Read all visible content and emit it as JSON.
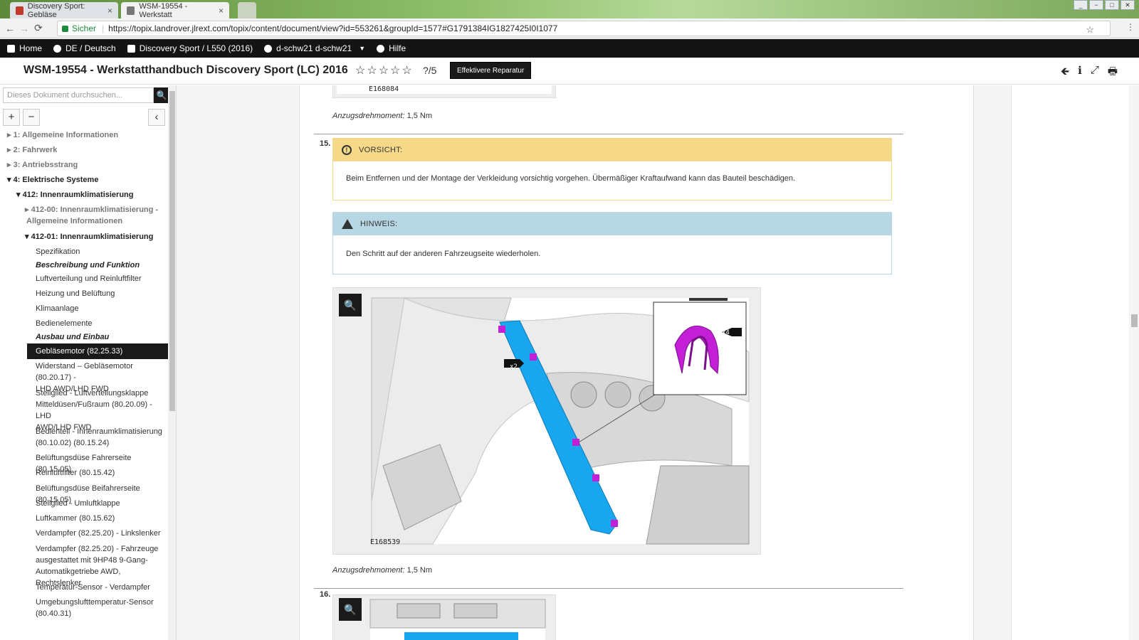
{
  "browser": {
    "tabs": [
      {
        "label": "Discovery Sport: Gebläse",
        "close": "×"
      },
      {
        "label": "WSM-19554 - Werkstatt",
        "close": "×"
      }
    ],
    "window_buttons": [
      "_",
      "−",
      "□",
      "✕"
    ],
    "nav": {
      "back": "←",
      "forward": "→",
      "reload": "⟳"
    },
    "secure_label": "Sicher",
    "url": "https://topix.landrover.jlrext.com/topix/content/document/view?id=553261&groupId=1577#G1791384IG1827425I0I1077",
    "bookmark": "☆",
    "menu": "⋮"
  },
  "appnav": {
    "home": "Home",
    "language": "DE / Deutsch",
    "vehicle": "Discovery Sport / L550 (2016)",
    "user": "d-schw21 d-schw21",
    "user_caret": "▼",
    "help": "Hilfe"
  },
  "header": {
    "title": "WSM-19554 - Werkstatthandbuch Discovery Sport (LC) 2016",
    "stars": "☆☆☆☆☆",
    "rating": "?/5",
    "button": "Effektivere Reparatur",
    "icons": {
      "back": "🡸",
      "info": "ℹ",
      "expand": "⤢",
      "print": "🖶"
    }
  },
  "sidebar": {
    "search_placeholder": "Dieses Dokument durchsuchen...",
    "search_icon": "🔍",
    "expand": "+",
    "collapse": "−",
    "hide": "‹",
    "tree": [
      {
        "label": "1: Allgemeine Informationen",
        "caret": "▸"
      },
      {
        "label": "2: Fahrwerk",
        "caret": "▸"
      },
      {
        "label": "3: Antriebsstrang",
        "caret": "▸"
      },
      {
        "label": "4: Elektrische Systeme",
        "caret": "▾"
      },
      {
        "label": "412: Innenraumklimatisierung",
        "caret": "▾"
      },
      {
        "label": "412-00: Innenraumklimatisierung -",
        "label2": "Allgemeine Informationen",
        "caret": "▸"
      },
      {
        "label": "412-01: Innenraumklimatisierung",
        "caret": "▾"
      },
      {
        "label": "Spezifikation"
      },
      {
        "label": "Beschreibung und Funktion"
      },
      {
        "label": "Luftverteilung und Reinluftfilter"
      },
      {
        "label": "Heizung und Belüftung"
      },
      {
        "label": "Klimaanlage"
      },
      {
        "label": "Bedienelemente"
      },
      {
        "label": "Ausbau und Einbau"
      },
      {
        "label": "Gebläsemotor (82.25.33)"
      },
      {
        "label": "Widerstand – Gebläsemotor (80.20.17) -",
        "label2": "LHD AWD/LHD FWD"
      },
      {
        "label": "Stellglied - Luftverteilungsklappe",
        "label2": "Mitteldüsen/Fußraum (80.20.09) - LHD",
        "label3": "AWD/LHD FWD"
      },
      {
        "label": "Bedienteil - Innenraumklimatisierung",
        "label2": "(80.10.02) (80.15.24)"
      },
      {
        "label": "Belüftungsdüse Fahrerseite (80.15.05)"
      },
      {
        "label": "Reinluftfilter (80.15.42)"
      },
      {
        "label": "Belüftungsdüse Beifahrerseite (80.15.05)"
      },
      {
        "label": "Stellglied - Umluftklappe"
      },
      {
        "label": "Luftkammer (80.15.62)"
      },
      {
        "label": "Verdampfer (82.25.20) - Linkslenker"
      },
      {
        "label": "Verdampfer (82.25.20) - Fahrzeuge",
        "label2": "ausgestattet mit 9HP48 9-Gang-",
        "label3": "Automatikgetriebe AWD, Rechtslenker"
      },
      {
        "label": "Temperatur-Sensor - Verdampfer"
      },
      {
        "label": "Umgebungslufttemperatur-Sensor",
        "label2": "(80.40.31)"
      }
    ]
  },
  "content": {
    "fig_top_label": "E168084",
    "torque1_label": "Anzugsdrehmoment:",
    "torque1_value": "1,5 Nm",
    "step15": "15.",
    "caution_title": "VORSICHT:",
    "caution_text": "Beim Entfernen und der Montage der Verkleidung vorsichtig vorgehen. Übermäßiger Kraftaufwand kann das Bauteil beschädigen.",
    "note_title": "HINWEIS:",
    "note_text": "Den Schritt auf der anderen Fahrzeugseite wiederholen.",
    "fig_label": "E168539",
    "callout_x2": "x2",
    "callout_x4": "x4",
    "torque2_label": "Anzugsdrehmoment:",
    "torque2_value": "1,5 Nm",
    "step16": "16.",
    "zoom_icon": "🔍"
  }
}
